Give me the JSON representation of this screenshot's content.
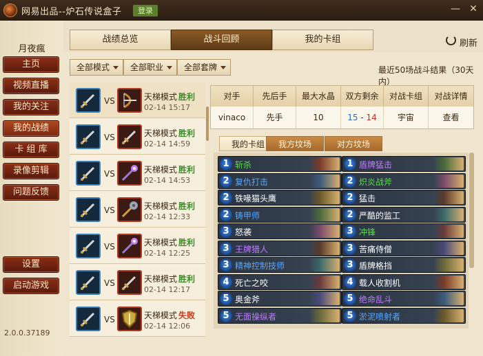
{
  "window": {
    "title": "网易出品--炉石传说盒子",
    "login_label": "登录",
    "minimize": "—",
    "close": "✕"
  },
  "sidebar": {
    "username": "月夜瘋",
    "items": [
      {
        "label": "主页"
      },
      {
        "label": "视频直播"
      },
      {
        "label": "我的关注"
      },
      {
        "label": "我的战绩"
      },
      {
        "label": "卡 组 库"
      },
      {
        "label": "录像剪辑"
      },
      {
        "label": "问题反馈"
      }
    ],
    "settings_label": "设置",
    "launch_label": "启动游戏",
    "version": "2.0.0.37189"
  },
  "tabs": [
    {
      "label": "战绩总览"
    },
    {
      "label": "战斗回顾"
    },
    {
      "label": "我的卡组"
    }
  ],
  "refresh_label": "刷新",
  "filters": [
    {
      "label": "全部模式"
    },
    {
      "label": "全部职业"
    },
    {
      "label": "全部套牌"
    }
  ],
  "summary": "最近50场战斗结果（30天内）",
  "matches": [
    {
      "vs": "VS",
      "mode": "天梯模式",
      "result": "胜利",
      "date": "02-14 15:17",
      "opp_icon": "bow-icon",
      "win": true
    },
    {
      "vs": "VS",
      "mode": "天梯模式",
      "result": "胜利",
      "date": "02-14 14:59",
      "opp_icon": "sword-icon",
      "win": true
    },
    {
      "vs": "VS",
      "mode": "天梯模式",
      "result": "胜利",
      "date": "02-14 14:53",
      "opp_icon": "staff-icon",
      "win": true
    },
    {
      "vs": "VS",
      "mode": "天梯模式",
      "result": "胜利",
      "date": "02-14 12:33",
      "opp_icon": "mace-icon",
      "win": true
    },
    {
      "vs": "VS",
      "mode": "天梯模式",
      "result": "胜利",
      "date": "02-14 12:25",
      "opp_icon": "staff-icon",
      "win": true
    },
    {
      "vs": "VS",
      "mode": "天梯模式",
      "result": "胜利",
      "date": "02-14 12:17",
      "opp_icon": "sword-icon",
      "win": true
    },
    {
      "vs": "VS",
      "mode": "天梯模式",
      "result": "失败",
      "date": "02-14 12:06",
      "opp_icon": "shield-icon",
      "win": false
    }
  ],
  "detail": {
    "headers": [
      "对手",
      "先后手",
      "最大水晶",
      "双方剩余",
      "对战卡组",
      "对战详情"
    ],
    "row": {
      "opponent": "vinaco",
      "turn": "先手",
      "max_mana": "10",
      "remaining_own": "15",
      "remaining_sep": " - ",
      "remaining_opp": "14",
      "deck": "宇宙",
      "details": "查看"
    }
  },
  "subtabs": [
    {
      "label": "我的卡组"
    },
    {
      "label": "我方坟场"
    },
    {
      "label": "对方坟场"
    }
  ],
  "cards_left": [
    {
      "cost": "1",
      "name": "斩杀",
      "rarity": "green"
    },
    {
      "cost": "2",
      "name": "复仇打击",
      "rarity": "rare"
    },
    {
      "cost": "2",
      "name": "铁喙猫头鹰",
      "rarity": "common"
    },
    {
      "cost": "2",
      "name": "铸甲师",
      "rarity": "rare"
    },
    {
      "cost": "3",
      "name": "怒袭",
      "rarity": "common"
    },
    {
      "cost": "3",
      "name": "王牌猎人",
      "rarity": "epic"
    },
    {
      "cost": "3",
      "name": "精神控制技师",
      "rarity": "rare"
    },
    {
      "cost": "4",
      "name": "死亡之咬",
      "rarity": "common"
    },
    {
      "cost": "5",
      "name": "奥金斧",
      "rarity": "common"
    },
    {
      "cost": "5",
      "name": "无面操纵者",
      "rarity": "epic"
    }
  ],
  "cards_right": [
    {
      "cost": "1",
      "name": "盾牌猛击",
      "rarity": "epic"
    },
    {
      "cost": "2",
      "name": "炽炎战斧",
      "rarity": "green"
    },
    {
      "cost": "2",
      "name": "猛击",
      "rarity": "common"
    },
    {
      "cost": "2",
      "name": "严酷的监工",
      "rarity": "common"
    },
    {
      "cost": "3",
      "name": "冲锋",
      "rarity": "green"
    },
    {
      "cost": "3",
      "name": "苦痛侍僧",
      "rarity": "common"
    },
    {
      "cost": "3",
      "name": "盾牌格挡",
      "rarity": "common"
    },
    {
      "cost": "4",
      "name": "载人收割机",
      "rarity": "common"
    },
    {
      "cost": "5",
      "name": "绝命乱斗",
      "rarity": "epic"
    },
    {
      "cost": "5",
      "name": "淤泥喷射者",
      "rarity": "rare"
    }
  ]
}
